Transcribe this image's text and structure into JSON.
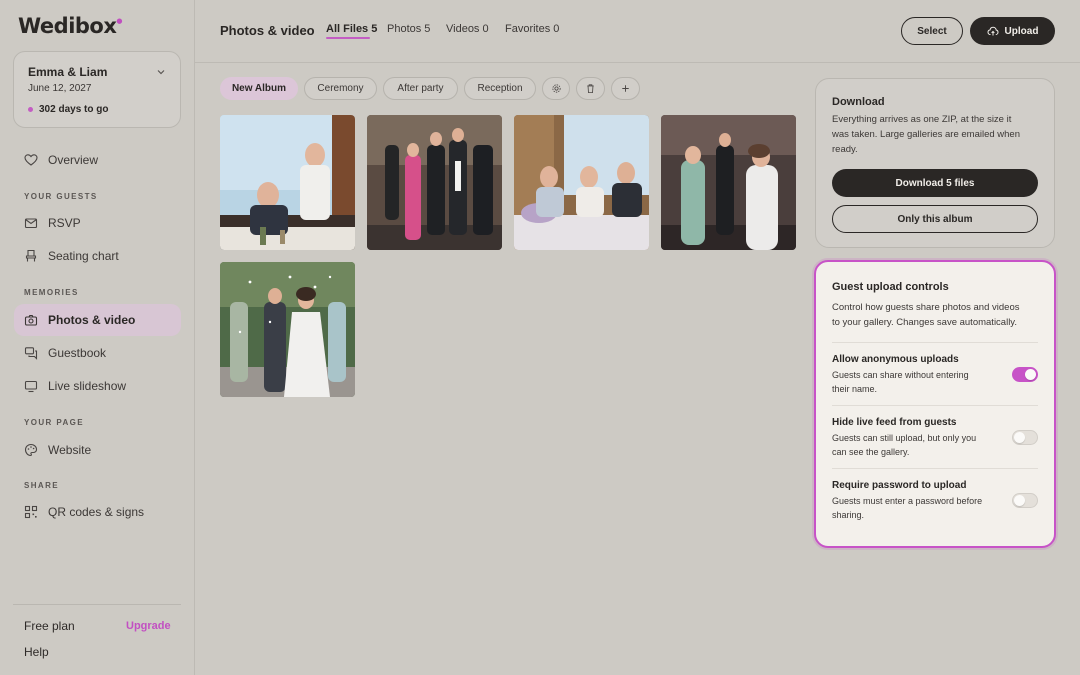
{
  "app": {
    "logo": "Wedibox"
  },
  "event": {
    "name": "Emma & Liam",
    "date": "June 12, 2027",
    "countdown": "302 days to go"
  },
  "sidebar": {
    "overview": "Overview",
    "sections": {
      "guests": "YOUR GUESTS",
      "memories": "MEMORIES",
      "page": "YOUR PAGE",
      "share": "SHARE"
    },
    "items": {
      "rsvp": "RSVP",
      "seating": "Seating chart",
      "photos": "Photos & video",
      "guestbook": "Guestbook",
      "slideshow": "Live slideshow",
      "website": "Website",
      "qr": "QR codes & signs"
    },
    "plan": "Free plan",
    "upgrade": "Upgrade",
    "help": "Help"
  },
  "header": {
    "title": "Photos & video",
    "tabs": [
      "All Files 5",
      "Photos 5",
      "Videos 0",
      "Favorites 0"
    ],
    "select_label": "Select",
    "upload_label": "Upload"
  },
  "albums": [
    "New Album",
    "Ceremony",
    "After party",
    "Reception"
  ],
  "download": {
    "title": "Download",
    "text_lines": [
      "Everything arrives as one ZIP, at the size it",
      "was taken. Large galleries are emailed when",
      "ready."
    ],
    "primary": "Download 5 files",
    "secondary": "Only this album"
  },
  "guest_controls": {
    "title": "Guest upload controls",
    "text_lines": [
      "Control how guests share photos and videos",
      "to your gallery. Changes save automatically."
    ],
    "settings": [
      {
        "title": "Allow anonymous uploads",
        "desc_lines": [
          "Guests can share without entering",
          "their name."
        ],
        "enabled": true
      },
      {
        "title": "Hide live feed from guests",
        "desc_lines": [
          "Guests can still upload, but only you",
          "can see the gallery."
        ],
        "enabled": false
      },
      {
        "title": "Require password to upload",
        "desc_lines": [
          "Guests must enter a password before",
          "sharing."
        ],
        "enabled": false
      }
    ]
  },
  "colors": {
    "accent": "#c753c7",
    "dark": "#2a2725",
    "background": "#cdcac4"
  }
}
